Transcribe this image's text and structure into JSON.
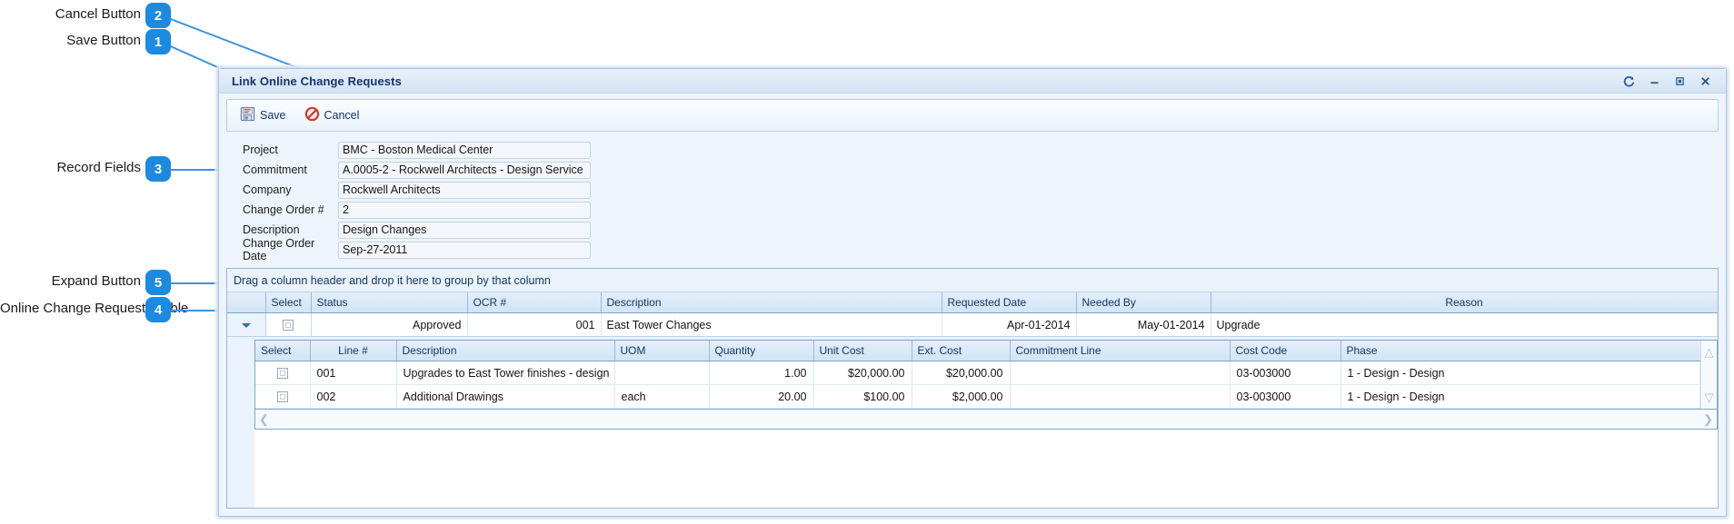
{
  "annotations": [
    {
      "id": "1",
      "label": "Save Button"
    },
    {
      "id": "2",
      "label": "Cancel Button"
    },
    {
      "id": "3",
      "label": "Record Fields"
    },
    {
      "id": "4",
      "label": "Online Change Requests Table"
    },
    {
      "id": "5",
      "label": "Expand Button"
    }
  ],
  "window": {
    "title": "Link Online Change Requests",
    "controls": [
      {
        "name": "refresh",
        "glyph": "↻"
      },
      {
        "name": "minimize",
        "glyph": "—"
      },
      {
        "name": "maximize",
        "glyph": "□"
      },
      {
        "name": "close",
        "glyph": "✕"
      }
    ]
  },
  "toolbar": {
    "save_label": "Save",
    "cancel_label": "Cancel"
  },
  "fields": [
    {
      "label": "Project",
      "value": "BMC - Boston Medical Center"
    },
    {
      "label": "Commitment",
      "value": "A.0005-2 - Rockwell Architects - Design Service"
    },
    {
      "label": "Company",
      "value": "Rockwell Architects"
    },
    {
      "label": "Change Order #",
      "value": "2"
    },
    {
      "label": "Description",
      "value": "Design Changes"
    },
    {
      "label": "Change Order Date",
      "value": "Sep-27-2011"
    }
  ],
  "grid": {
    "group_hint": "Drag a column header and drop it here to group by that column",
    "columns": [
      {
        "key": "expander",
        "label": "",
        "align": "c"
      },
      {
        "key": "select",
        "label": "Select",
        "align": "l"
      },
      {
        "key": "status",
        "label": "Status",
        "align": "r"
      },
      {
        "key": "ocr",
        "label": "OCR #",
        "align": "r"
      },
      {
        "key": "desc",
        "label": "Description",
        "align": "l"
      },
      {
        "key": "requested",
        "label": "Requested Date",
        "align": "r"
      },
      {
        "key": "needed",
        "label": "Needed By",
        "align": "r"
      },
      {
        "key": "reason",
        "label": "Reason",
        "align": "l"
      }
    ],
    "rows": [
      {
        "status": "Approved",
        "ocr": "001",
        "desc": "East Tower Changes",
        "requested": "Apr-01-2014",
        "needed": "May-01-2014",
        "reason": "Upgrade"
      }
    ]
  },
  "detail_grid": {
    "columns": [
      {
        "key": "select",
        "label": "Select",
        "align": "c"
      },
      {
        "key": "line",
        "label": "Line #",
        "align": "l"
      },
      {
        "key": "desc",
        "label": "Description",
        "align": "l"
      },
      {
        "key": "uom",
        "label": "UOM",
        "align": "l"
      },
      {
        "key": "qty",
        "label": "Quantity",
        "align": "r"
      },
      {
        "key": "unit_cost",
        "label": "Unit Cost",
        "align": "r"
      },
      {
        "key": "ext_cost",
        "label": "Ext. Cost",
        "align": "r"
      },
      {
        "key": "commit",
        "label": "Commitment Line",
        "align": "l"
      },
      {
        "key": "cost_code",
        "label": "Cost Code",
        "align": "l"
      },
      {
        "key": "phase",
        "label": "Phase",
        "align": "l"
      }
    ],
    "rows": [
      {
        "line": "001",
        "desc": "Upgrades to East Tower finishes - design",
        "uom": "",
        "qty": "1.00",
        "unit_cost": "$20,000.00",
        "ext_cost": "$20,000.00",
        "commit": "",
        "cost_code": "03-003000",
        "phase": "1 - Design - Design"
      },
      {
        "line": "002",
        "desc": "Additional Drawings",
        "uom": "each",
        "qty": "20.00",
        "unit_cost": "$100.00",
        "ext_cost": "$2,000.00",
        "commit": "",
        "cost_code": "03-003000",
        "phase": "1 - Design - Design"
      }
    ]
  },
  "colors": {
    "accent": "#1b8ae0",
    "title_text": "#15356b",
    "header_text": "#113767",
    "grid_border": "#9cb8d4"
  }
}
